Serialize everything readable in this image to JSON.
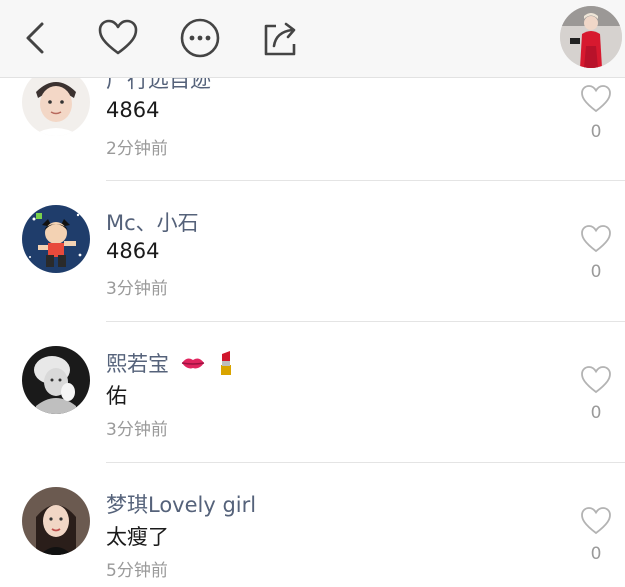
{
  "comments": [
    {
      "username": "广行远自迹",
      "text": "4864",
      "time": "2分钟前",
      "likes": "0"
    },
    {
      "username": "Mc、小石",
      "text": "4864",
      "time": "3分钟前",
      "likes": "0"
    },
    {
      "username": "熙若宝",
      "text": "佑",
      "time": "3分钟前",
      "likes": "0",
      "username_icons": [
        "kiss-lips-icon",
        "lipstick-icon"
      ]
    },
    {
      "username": "梦琪Lovely girl",
      "text": "太瘦了",
      "time": "5分钟前",
      "likes": "0"
    }
  ],
  "icons": {
    "back": "chevron-left-icon",
    "like": "heart-outline-icon",
    "more": "ellipsis-circle-icon",
    "share": "share-icon"
  },
  "colors": {
    "username": "#55627a",
    "text": "#1a1a1a",
    "secondary": "#9a9a9a",
    "topbar_bg": "#f7f7f7",
    "lipstick": "#d0162c"
  }
}
